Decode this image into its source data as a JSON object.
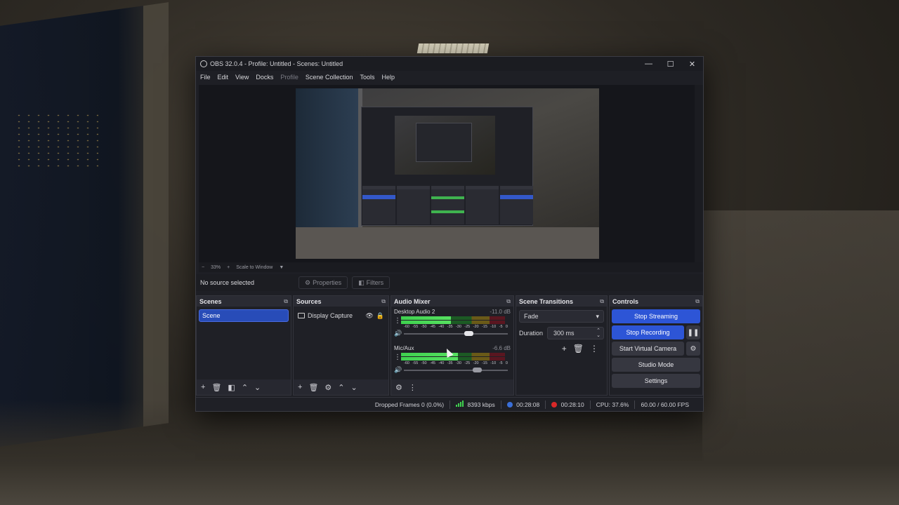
{
  "window": {
    "title": "OBS 32.0.4 - Profile: Untitled - Scenes: Untitled",
    "controls": [
      "—",
      "☐",
      "✕"
    ]
  },
  "menu": [
    "File",
    "Edit",
    "View",
    "Docks",
    "Profile",
    "Scene Collection",
    "Tools",
    "Help"
  ],
  "preview": {
    "zoom_out": "−",
    "zoom": "33%",
    "zoom_in": "+",
    "scale": "Scale to Window",
    "scale_arrow": "▼"
  },
  "context": {
    "label": "No source selected",
    "properties": "Properties",
    "filters": "Filters"
  },
  "scenes": {
    "title": "Scenes",
    "items": [
      "Scene"
    ]
  },
  "sources": {
    "title": "Sources",
    "items": [
      "Display Capture"
    ]
  },
  "mixer": {
    "title": "Audio Mixer",
    "channels": [
      {
        "name": "Desktop Audio 2",
        "db": "-11.0 dB",
        "level": 0.48,
        "volume": 0.62
      },
      {
        "name": "Mic/Aux",
        "db": "-6.6 dB",
        "level": 0.55,
        "volume": 0.7
      }
    ],
    "scale": [
      "-60",
      "-55",
      "-50",
      "-45",
      "-40",
      "-35",
      "-30",
      "-25",
      "-20",
      "-15",
      "-10",
      "-5",
      "0"
    ]
  },
  "transitions": {
    "title": "Scene Transitions",
    "selected": "Fade",
    "duration_label": "Duration",
    "duration_value": "300 ms"
  },
  "controls": {
    "title": "Controls",
    "stop_streaming": "Stop Streaming",
    "stop_recording": "Stop Recording",
    "start_virtual_camera": "Start Virtual Camera",
    "studio_mode": "Studio Mode",
    "settings": "Settings"
  },
  "status": {
    "dropped": "Dropped Frames 0 (0.0%)",
    "bitrate": "8393 kbps",
    "stream_time": "00:28:08",
    "rec_time": "00:28:10",
    "cpu": "CPU: 37.6%",
    "fps": "60.00 / 60.00 FPS"
  },
  "icons": {
    "undock": "⧉",
    "add": "+",
    "remove": "🗑",
    "filter": "◧",
    "up": "⌃",
    "down": "⌄",
    "gear": "⚙",
    "eye": "👁",
    "lock": "🔒",
    "speaker": "🔊",
    "dots": "⋮",
    "pause": "❚❚",
    "chevron": "▾",
    "spinner_up": "⌃",
    "spinner_down": "⌄"
  },
  "colors": {
    "accent": "#2d55d6",
    "meter_green": "#3fd14f",
    "record_red": "#d92828"
  }
}
